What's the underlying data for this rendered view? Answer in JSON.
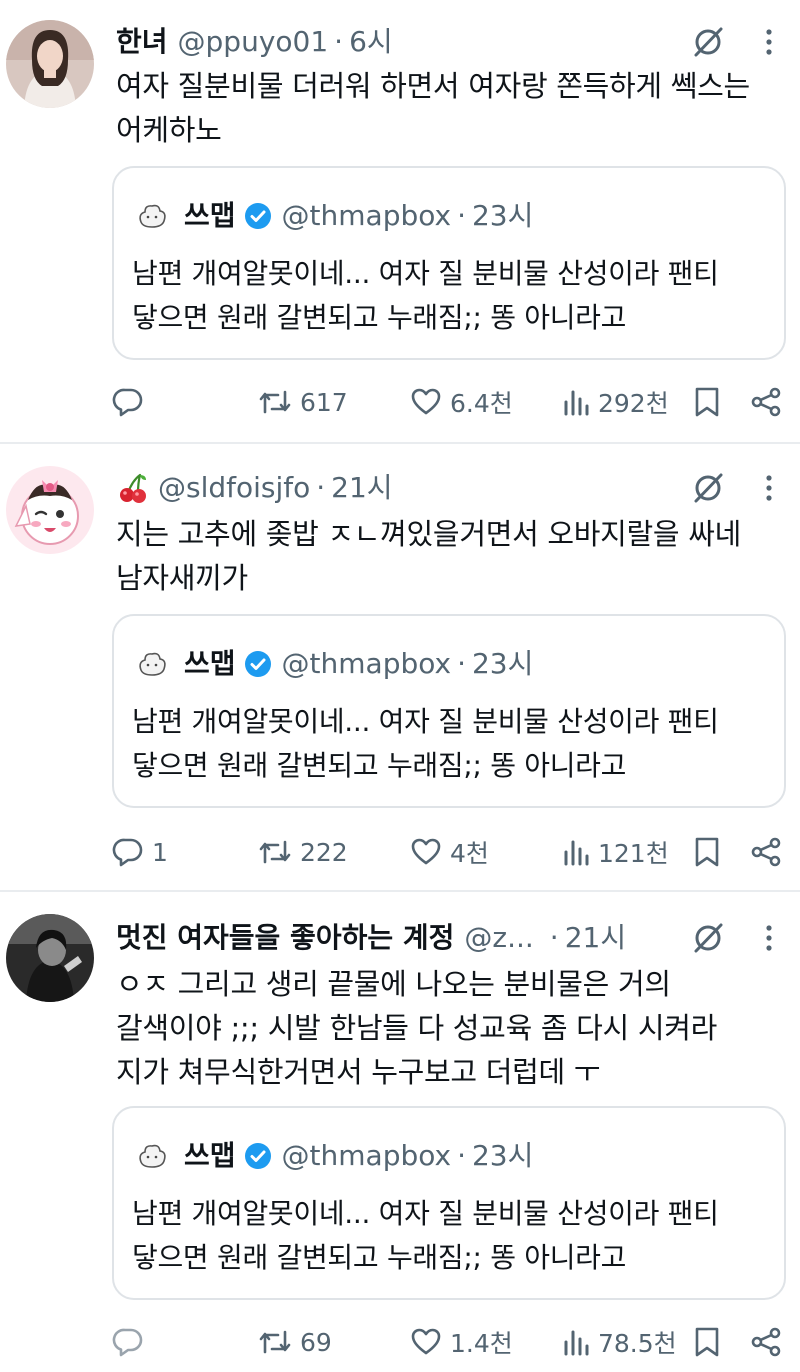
{
  "tweets": [
    {
      "display_name": "한녀",
      "handle": "@ppuyo01",
      "dot": "·",
      "time": "6시",
      "text_lines": [
        "여자 질분비물 더러워 하면서 여자랑 쫀득하게 쎅스는",
        "어케하노"
      ],
      "quote": {
        "name": "쓰맵",
        "handle": "@thmapbox",
        "dot": "·",
        "time": "23시",
        "text_lines": [
          "남편 개여알못이네... 여자 질 분비물 산성이라 팬티",
          "닿으면 원래 갈변되고 누래짐;; 똥 아니라고"
        ]
      },
      "actions": {
        "replies": "",
        "retweets": "617",
        "likes": "6.4천",
        "views": "292천"
      }
    },
    {
      "display_name": "",
      "emoji": "cherry-emoji",
      "handle": "@sldfoisjfo",
      "dot": "·",
      "time": "21시",
      "text_lines": [
        "지는 고추에 좆밥 ㅈㄴ껴있을거면서 오바지랄을 싸네",
        "남자새끼가"
      ],
      "quote": {
        "name": "쓰맵",
        "handle": "@thmapbox",
        "dot": "·",
        "time": "23시",
        "text_lines": [
          "남편 개여알못이네... 여자 질 분비물 산성이라 팬티",
          "닿으면 원래 갈변되고 누래짐;; 똥 아니라고"
        ]
      },
      "actions": {
        "replies": "1",
        "retweets": "222",
        "likes": "4천",
        "views": "121천"
      }
    },
    {
      "display_name": "멋진 여자들을 좋아하는 계정",
      "handle": "@z...",
      "dot": "·",
      "time": "21시",
      "text_lines": [
        "ㅇㅈ 그리고 생리 끝물에 나오는 분비물은 거의",
        "갈색이야 ;;; 시발 한남들 다 성교육 좀 다시 시켜라",
        "지가 쳐무식한거면서 누구보고 더럽데 ㅜ"
      ],
      "quote": {
        "name": "쓰맵",
        "handle": "@thmapbox",
        "dot": "·",
        "time": "23시",
        "text_lines": [
          "남편 개여알못이네... 여자 질 분비물 산성이라 팬티",
          "닿으면 원래 갈변되고 누래짐;; 똥 아니라고"
        ]
      },
      "actions": {
        "replies": "",
        "retweets": "69",
        "likes": "1.4천",
        "views": "78.5천"
      }
    }
  ],
  "icons": {
    "reply": "reply-icon",
    "retweet": "retweet-icon",
    "like": "heart-icon",
    "views": "views-icon",
    "bookmark": "bookmark-icon",
    "share": "share-icon",
    "grok": "grok-icon",
    "more": "more-icon",
    "verified": "verified-badge-icon"
  },
  "colors": {
    "text": "#0f1419",
    "secondary": "#536471",
    "verified": "#1d9bf0",
    "border": "#dfe3e7"
  }
}
